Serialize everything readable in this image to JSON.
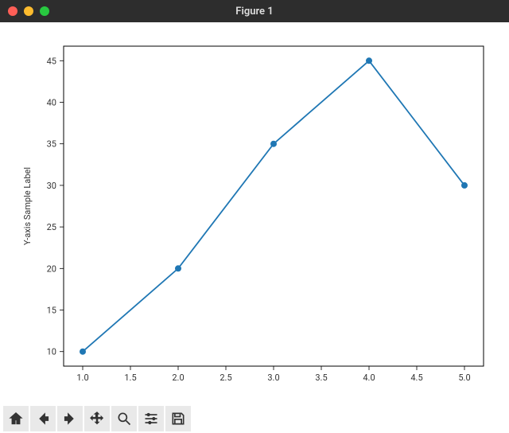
{
  "window": {
    "title": "Figure 1"
  },
  "toolbar": {
    "home": "Home",
    "back": "Back",
    "forward": "Forward",
    "pan": "Pan",
    "zoom": "Zoom",
    "config": "Configure subplots",
    "save": "Save"
  },
  "chart_data": {
    "type": "line",
    "x": [
      1.0,
      2.0,
      3.0,
      4.0,
      5.0
    ],
    "y": [
      10,
      20,
      35,
      45,
      30
    ],
    "xticks": [
      "1.0",
      "1.5",
      "2.0",
      "2.5",
      "3.0",
      "3.5",
      "4.0",
      "4.5",
      "5.0"
    ],
    "yticks": [
      "10",
      "15",
      "20",
      "25",
      "30",
      "35",
      "40",
      "45"
    ],
    "xlim": [
      1.0,
      5.0
    ],
    "ylim": [
      10,
      45
    ],
    "xlabel": "",
    "ylabel": "Y-axis Sample Label",
    "title": "",
    "line_color": "#1f77b4"
  }
}
